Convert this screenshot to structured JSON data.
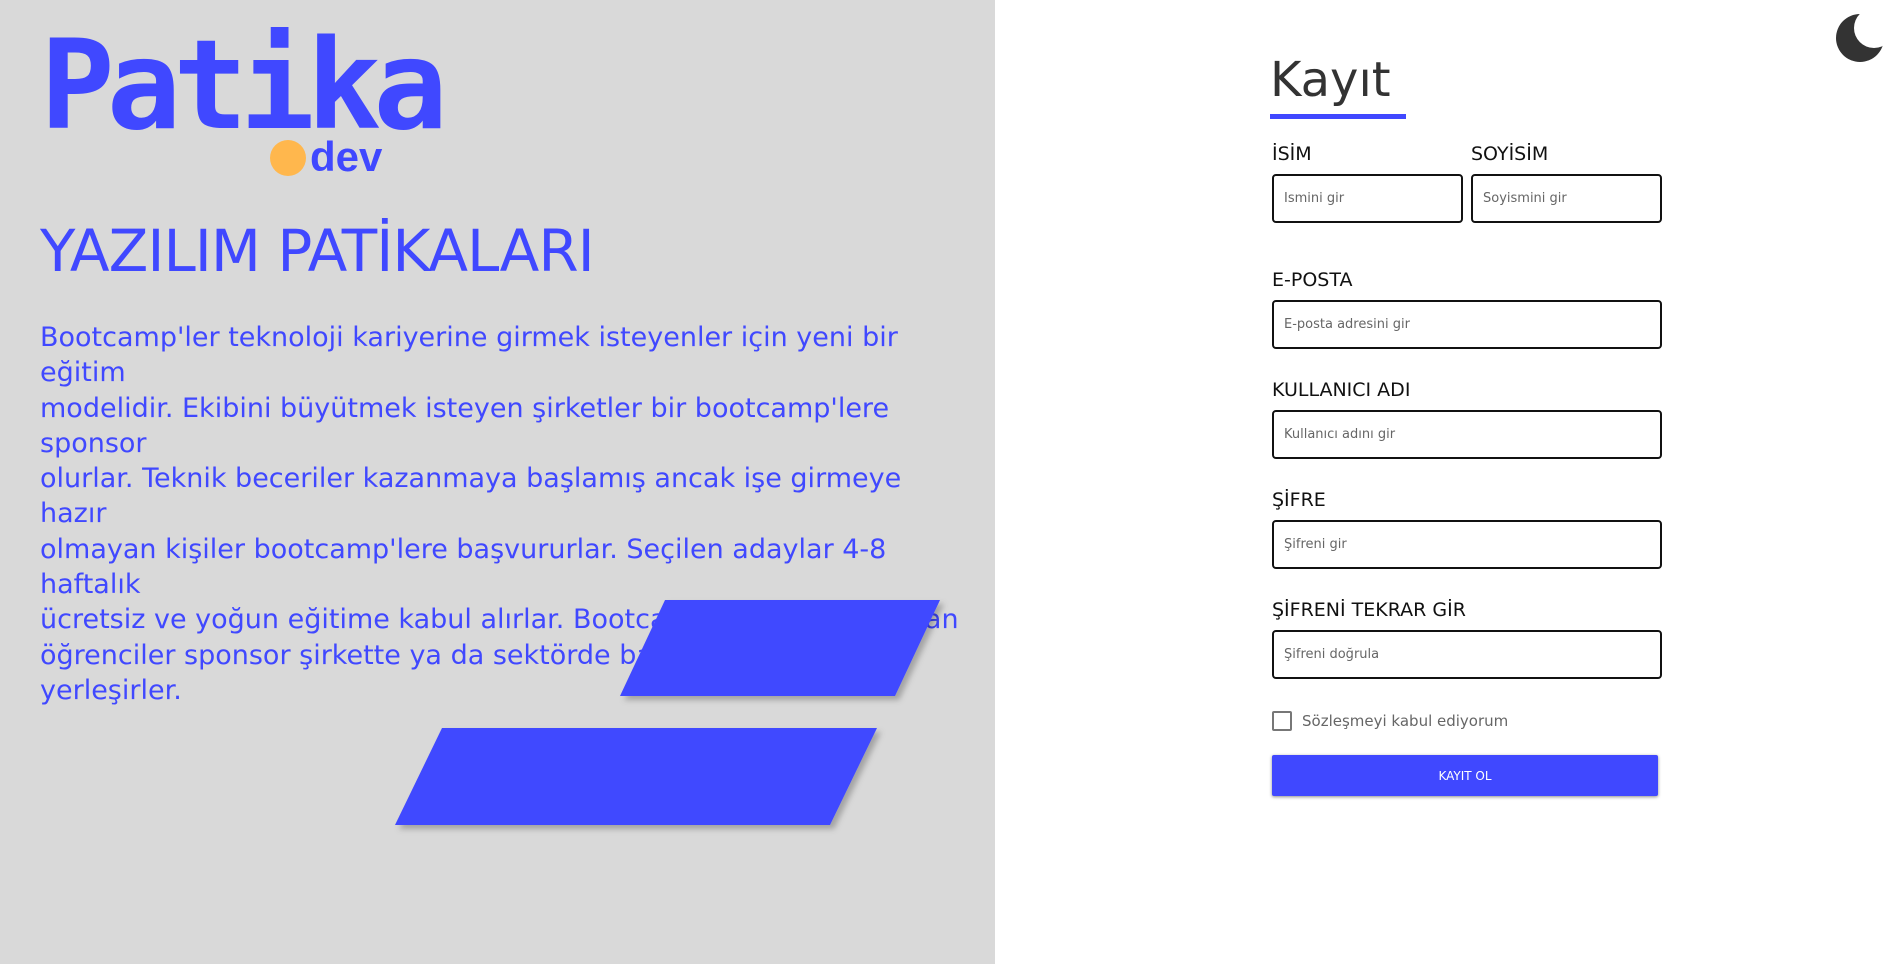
{
  "brand": {
    "logo_text": "Patika",
    "logo_sub": "dev",
    "dot_color": "#ffb74d",
    "accent_color": "#4048ff"
  },
  "hero": {
    "headline": "YAZILIM PATİKALARI",
    "description_lines": [
      "Bootcamp'ler teknoloji kariyerine girmek isteyenler için yeni bir eğitim",
      "modelidir. Ekibini büyütmek isteyen şirketler bir bootcamp'lere sponsor",
      "olurlar. Teknik beceriler kazanmaya başlamış ancak işe girmeye hazır",
      "olmayan kişiler bootcamp'lere başvururlar. Seçilen adaylar 4-8 haftalık",
      "ücretsiz ve yoğun eğitime kabul alırlar. Bootcamp'lerde başarılı olan",
      "öğrenciler sponsor şirkette ya da sektörde başka şirketlere işe yerleşirler."
    ]
  },
  "theme_toggle": {
    "icon": "moon-icon"
  },
  "form": {
    "title": "Kayıt",
    "first_name": {
      "label": "İSİM",
      "placeholder": "İsmini gir",
      "value": ""
    },
    "last_name": {
      "label": "SOYİSİM",
      "placeholder": "Soyismini gir",
      "value": ""
    },
    "email": {
      "label": "E-POSTA",
      "placeholder": "E-posta adresini gir",
      "value": ""
    },
    "username": {
      "label": "KULLANICI ADI",
      "placeholder": "Kullanıcı adını gir",
      "value": ""
    },
    "password": {
      "label": "ŞİFRE",
      "placeholder": "Şifreni gir",
      "value": ""
    },
    "password_confirm": {
      "label": "ŞİFRENİ TEKRAR GİR",
      "placeholder": "Şifreni doğrula",
      "value": ""
    },
    "agreement_label": "Sözleşmeyi kabul ediyorum",
    "agreement_checked": false,
    "submit_label": "KAYIT OL"
  }
}
